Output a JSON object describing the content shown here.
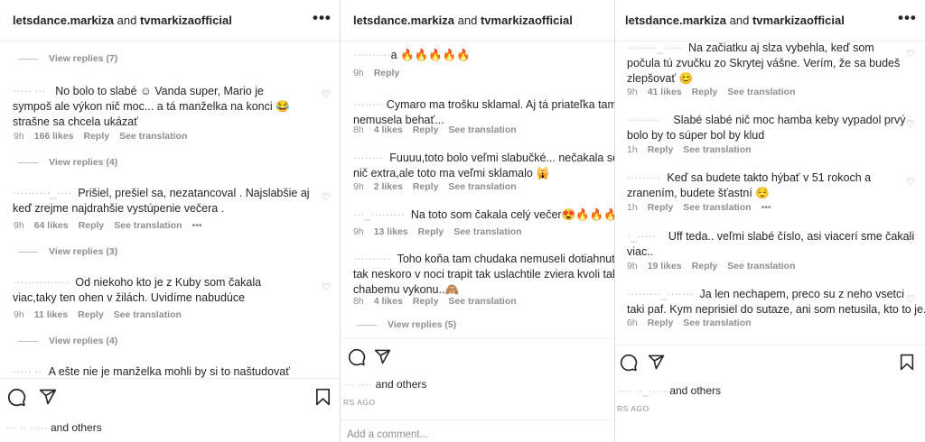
{
  "header": {
    "account1": "letsdance.markiza",
    "connector": "and",
    "account2": "tvmarkizaofficial",
    "more": "•••"
  },
  "labels": {
    "reply": "Reply",
    "see_translation": "See translation",
    "others": "and others",
    "time_ago": "RS AGO",
    "add_comment": "Add a comment..."
  },
  "panel1": {
    "comments": [
      {
        "user": "····· ···",
        "text": [
          "No bolo to slabé ☺ Vanda super, Mario je",
          "sympoš ale výkon nič moc... a tá manželka na konci 😂",
          "strašne sa chcela ukázať"
        ],
        "time": "9h",
        "likes": "166 likes"
      },
      {
        "user": "··········_····",
        "text": [
          "Prišiel, prešiel sa, nezatancoval . Najslabšie aj",
          "keď zrejme najdrahšie vystúpenie večera ."
        ],
        "time": "9h",
        "likes": "64 likes",
        "more": "•••"
      },
      {
        "user": "···············",
        "text": [
          "Od niekoho kto je z Kuby som čakala",
          "viac,taky ten ohen v žilách. Uvidíme nabudúce"
        ],
        "time": "9h",
        "likes": "11 likes"
      }
    ],
    "view_replies": [
      "View replies (7)",
      "View replies (4)",
      "View replies (3)",
      "View replies (4)"
    ],
    "partial_text": "A ešte nie je manželka mohli by si to naštudovať",
    "likes_user": "··· ·· ·····"
  },
  "panel2": {
    "comments": [
      {
        "user": "··········",
        "text": [
          "a 🔥🔥🔥🔥🔥"
        ],
        "time": "9h",
        "likes": ""
      },
      {
        "user": "········",
        "text": [
          "Cymaro ma trošku sklamal. Aj tá priateľka tam",
          "nemusela behať..."
        ],
        "time": "8h",
        "likes": "4 likes"
      },
      {
        "user": "········",
        "text": [
          "Fuuuu,toto bolo veľmi slabučké... nečakala som",
          "nič extra,ale toto ma veľmi sklamalo 🙀"
        ],
        "time": "9h",
        "likes": "2 likes"
      },
      {
        "user": "···_·········",
        "text": [
          "Na toto som čakala celý večer😍🔥🔥🔥"
        ],
        "time": "9h",
        "likes": "13 likes"
      },
      {
        "user": "··········",
        "text": [
          "Toho koňa tam chudaka nemuseli dotiahnuť",
          "tak neskoro v noci trapit tak uslachtile zviera kvoli tak",
          "chabemu vykonu..🙈"
        ],
        "time": "8h",
        "likes": "4 likes"
      }
    ],
    "view_replies": "View replies (5)",
    "likes_user": "··· ····"
  },
  "panel3": {
    "comments": [
      {
        "user": "········_·····",
        "text": [
          "Na začiatku aj slza vybehla, keď som",
          "počula tú zvučku zo Skrytej vášne. Verím, že sa budeš",
          "zlepšovať 😊"
        ],
        "time": "9h",
        "likes": "41 likes"
      },
      {
        "user": "·········",
        "text": [
          "Slabé slabé nič moc hamba keby vypadol prvý",
          "bolo by to súper bol by klud"
        ],
        "time": "1h",
        "likes": ""
      },
      {
        "user": "·········",
        "text": [
          "Keď sa budete takto hýbať v 51 rokoch a",
          "zranením, budete šťastní 😌"
        ],
        "time": "1h",
        "likes": "",
        "more": "•••"
      },
      {
        "user": "·_·····",
        "text": [
          "Uff teda.. veľmi slabé číslo, asi viacerí sme čakali",
          "viac.."
        ],
        "time": "9h",
        "likes": "19 likes"
      },
      {
        "user": "·········_·······",
        "text": [
          "Ja len nechapem, preco su z neho vsetci",
          "taki paf. Kym neprisiel do sutaze, ani som netusila, kto to je."
        ],
        "time": "6h",
        "likes": ""
      }
    ],
    "likes_user": "···· ··_·····"
  },
  "colors": {
    "text": "#262626",
    "secondary": "#8e8e8e",
    "divider": "#dbdbdb"
  }
}
